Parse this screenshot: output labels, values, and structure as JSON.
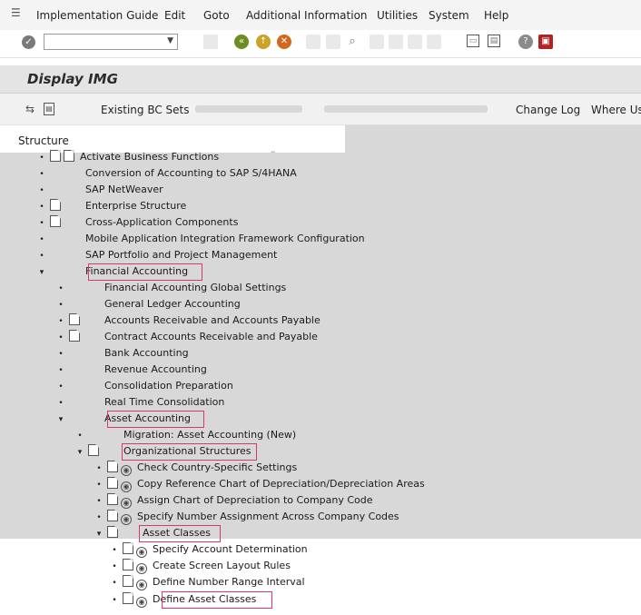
{
  "menubar": {
    "items": [
      "Implementation Guide",
      "Edit",
      "Goto",
      "Additional Information",
      "Utilities",
      "System",
      "Help"
    ]
  },
  "toolbar": {
    "command_value": "",
    "icons": [
      "check-icon",
      "back-icon",
      "exit-icon",
      "cancel-icon",
      "layout-icon",
      "display-icon"
    ]
  },
  "title": "Display IMG",
  "appbar": {
    "existing_bc_sets": "Existing BC Sets",
    "change_log": "Change Log",
    "where_used": "Where Us"
  },
  "tree": {
    "structure_label": "Structure",
    "nodes": [
      {
        "label": "Activate Business Functions",
        "bullet": "•"
      },
      {
        "label": "Conversion  of Accounting to SAP S/4HANA",
        "bullet": "•"
      },
      {
        "label": "SAP NetWeaver",
        "bullet": "•"
      },
      {
        "label": "Enterprise Structure",
        "bullet": "•"
      },
      {
        "label": "Cross-Application Components",
        "bullet": "•"
      },
      {
        "label": "Mobile Application Integration Framework Configuration",
        "bullet": "•"
      },
      {
        "label": "SAP Portfolio and Project Management",
        "bullet": "•"
      },
      {
        "label": "Financial Accounting",
        "bullet": "▾"
      },
      {
        "label": "Financial Accounting Global Settings",
        "bullet": "•"
      },
      {
        "label": "General Ledger Accounting",
        "bullet": "•"
      },
      {
        "label": "Accounts Receivable and Accounts Payable",
        "bullet": "•"
      },
      {
        "label": "Contract Accounts Receivable and Payable",
        "bullet": "•"
      },
      {
        "label": "Bank Accounting",
        "bullet": "•"
      },
      {
        "label": "Revenue Accounting",
        "bullet": "•"
      },
      {
        "label": "Consolidation Preparation",
        "bullet": "•"
      },
      {
        "label": "Real Time Consolidation",
        "bullet": "•"
      },
      {
        "label": "Asset Accounting",
        "bullet": "▾"
      },
      {
        "label": "Migration: Asset Accounting (New)",
        "bullet": "•"
      },
      {
        "label": "Organizational Structures",
        "bullet": "▾"
      },
      {
        "label": "Check Country-Specific Settings",
        "bullet": "•"
      },
      {
        "label": "Copy Reference Chart of Depreciation/Depreciation Areas",
        "bullet": "•"
      },
      {
        "label": "Assign Chart of Depreciation to Company Code",
        "bullet": "•"
      },
      {
        "label": "Specify Number Assignment Across Company Codes",
        "bullet": "•"
      },
      {
        "label": "Asset Classes",
        "bullet": "▾"
      },
      {
        "label": "Specify Account Determination",
        "bullet": "•"
      },
      {
        "label": "Create Screen Layout Rules",
        "bullet": "•"
      },
      {
        "label": "Define Number Range Interval",
        "bullet": "•"
      },
      {
        "label": "Define Asset Classes",
        "bullet": "•"
      }
    ]
  },
  "colors": {
    "highlight": "#d63a66",
    "tree_background": "#d8d8d8"
  }
}
